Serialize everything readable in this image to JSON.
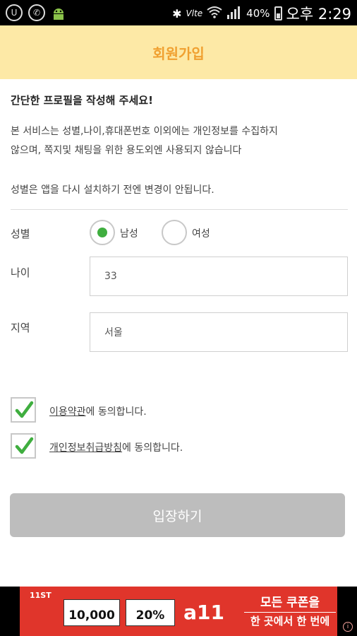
{
  "status_bar": {
    "network": "Vlte",
    "battery": "40%",
    "time": "오후 2:29"
  },
  "header": {
    "title": "회원가입"
  },
  "intro": {
    "title": "간단한 프로필을 작성해 주세요!",
    "desc_line1": "본 서비스는 성별,나이,휴대폰번호 이외에는 개인정보를 수집하지",
    "desc_line2": "않으며, 쪽지및 채팅을 위한 용도외엔 사용되지 않습니다",
    "gender_note": "성별은 앱을 다시 설치하기 전엔 변경이 안됩니다."
  },
  "form": {
    "gender_label": "성별",
    "male_label": "남성",
    "female_label": "여성",
    "selected_gender": "남성",
    "age_label": "나이",
    "age_value": "33",
    "region_label": "지역",
    "region_value": "서울"
  },
  "agreements": [
    {
      "link": "이용약관",
      "suffix": "에 동의합니다.",
      "checked": true
    },
    {
      "link": "개인정보취급방침",
      "suffix": "에 동의합니다.",
      "checked": true
    }
  ],
  "enter_button": "입장하기",
  "ad": {
    "logo": "11ST",
    "coupon1": "10,000",
    "coupon2": "20%",
    "brand": "a11",
    "line1": "모든 쿠폰을",
    "line2": "한 곳에서 한 번에",
    "info": "i"
  },
  "colors": {
    "header_bg": "#fde9a6",
    "header_text": "#f0a030",
    "check_green": "#3fae3f",
    "button_disabled": "#bdbdbd",
    "ad_red": "#e0352b"
  }
}
